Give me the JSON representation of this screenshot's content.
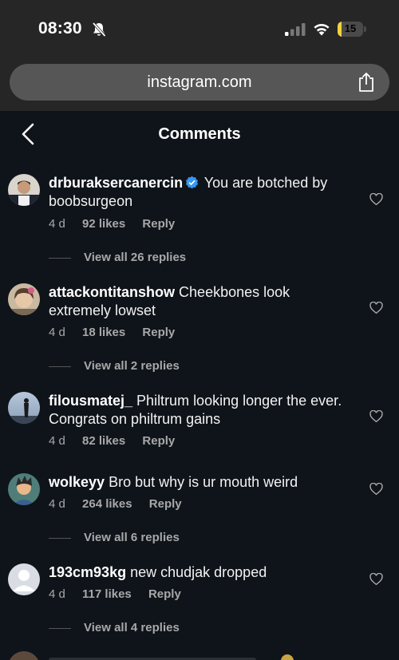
{
  "status_bar": {
    "time": "08:30",
    "battery_level": "15",
    "battery_fraction": 0.15
  },
  "browser": {
    "url": "instagram.com"
  },
  "header": {
    "title": "Comments"
  },
  "icons": {
    "back": "chevron-left-icon",
    "share": "share-icon",
    "like": "heart-outline-icon",
    "verified": "verified-badge-icon",
    "mute": "bell-slash-icon"
  },
  "colors": {
    "background": "#0f141a",
    "browser_chrome": "#262626",
    "secondary_text": "#a8a8a8",
    "verified": "#3897f0",
    "battery": "#f2d33d"
  },
  "comments": [
    {
      "username": "drburaksercanercin",
      "verified": true,
      "text": "You are botched by boobsurgeon",
      "time": "4 d",
      "likes": "92 likes",
      "reply": "Reply",
      "view_replies": "View all 26 replies"
    },
    {
      "username": "attackontitanshow",
      "verified": false,
      "text": "Cheekbones look extremely lowset",
      "time": "4 d",
      "likes": "18 likes",
      "reply": "Reply",
      "view_replies": "View all 2 replies"
    },
    {
      "username": "filousmatej_",
      "verified": false,
      "text": "Philtrum looking longer the ever. Congrats on philtrum gains",
      "time": "4 d",
      "likes": "82 likes",
      "reply": "Reply",
      "view_replies": ""
    },
    {
      "username": "wolkeyy",
      "verified": false,
      "text": "Bro but why is ur mouth weird",
      "time": "4 d",
      "likes": "264 likes",
      "reply": "Reply",
      "view_replies": "View all 6 replies"
    },
    {
      "username": "193cm93kg",
      "verified": false,
      "text": "new chudjak dropped",
      "time": "4 d",
      "likes": "117 likes",
      "reply": "Reply",
      "view_replies": "View all 4 replies"
    }
  ]
}
